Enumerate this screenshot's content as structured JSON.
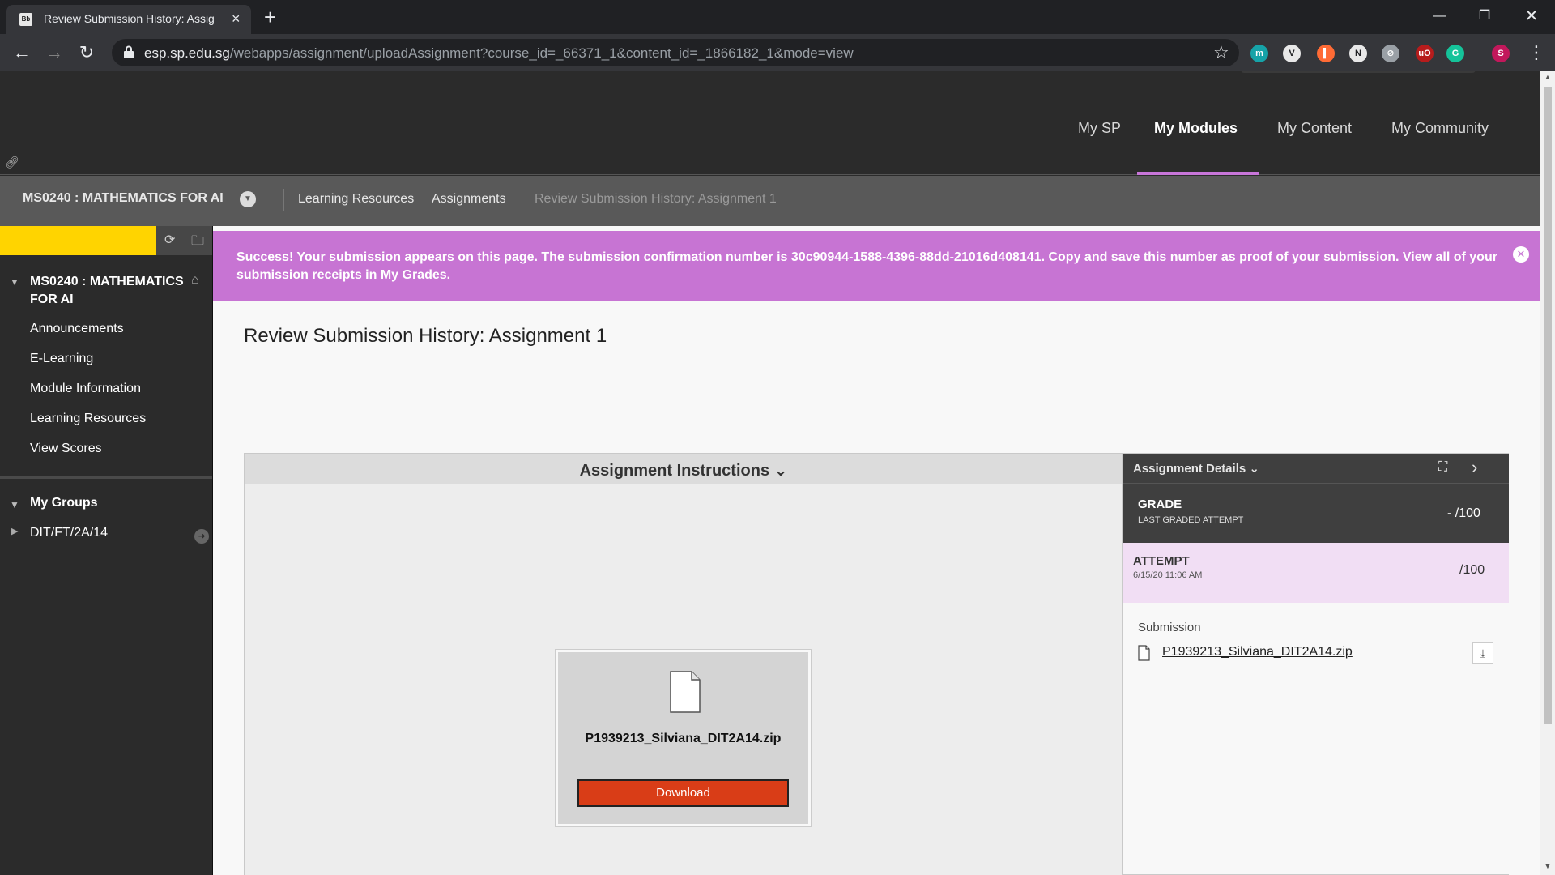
{
  "browser": {
    "tab_title": "Review Submission History: Assig",
    "favicon_text": "Bb",
    "url_host": "esp.sp.edu.sg",
    "url_path": "/webapps/assignment/uploadAssignment?course_id=_66371_1&content_id=_1866182_1&mode=view",
    "extensions": [
      {
        "name": "meet-extension-icon",
        "glyph": "m",
        "color": "#16a3a8"
      },
      {
        "name": "v-extension-icon",
        "glyph": "V",
        "color": "#e8e8e8"
      },
      {
        "name": "bookmark-extension-icon",
        "glyph": "▌",
        "color": "#ff6b35"
      },
      {
        "name": "notion-extension-icon",
        "glyph": "N",
        "color": "#e8e8e8"
      },
      {
        "name": "compass-extension-icon",
        "glyph": "⊘",
        "color": "#9aa0a6"
      },
      {
        "name": "ublock-extension-icon",
        "glyph": "uO",
        "color": "#b71c1c"
      },
      {
        "name": "grammarly-extension-icon",
        "glyph": "G",
        "color": "#15c39a"
      },
      {
        "name": "profile-avatar-icon",
        "glyph": "S",
        "color": "#c2185b"
      }
    ]
  },
  "top_nav": {
    "my_sp": "My SP",
    "my_modules": "My Modules",
    "my_content": "My Content",
    "my_community": "My Community"
  },
  "breadcrumbs": {
    "course": "MS0240 : MATHEMATICS FOR AI",
    "learning_resources": "Learning Resources",
    "assignments": "Assignments",
    "current": "Review Submission History: Assignment 1"
  },
  "sidebar": {
    "course_title": "MS0240 : MATHEMATICS FOR AI",
    "links": {
      "announcements": "Announcements",
      "elearning": "E-Learning",
      "module_info": "Module Information",
      "learning_resources": "Learning Resources",
      "view_scores": "View Scores"
    },
    "groups_title": "My Groups",
    "group_item": "DIT/FT/2A/14"
  },
  "alert": {
    "message": "Success! Your submission appears on this page. The submission confirmation number is 30c90944-1588-4396-88dd-21016d408141. Copy and save this number as proof of your submission. View all of your submission receipts in My Grades."
  },
  "main": {
    "page_title": "Review Submission History: Assignment 1",
    "instructions_label": "Assignment Instructions",
    "file_name": "P1939213_Silviana_DIT2A14.zip",
    "download_label": "Download"
  },
  "details": {
    "toggle_label": "Assignment Details",
    "grade_label": "GRADE",
    "grade_sub": "LAST GRADED ATTEMPT",
    "grade_value": "- /100",
    "attempt_label": "ATTEMPT",
    "attempt_date": "6/15/20 11:06 AM",
    "attempt_value": "/100",
    "submission_label": "Submission",
    "submission_file": "P1939213_Silviana_DIT2A14.zip"
  },
  "colors": {
    "alert_bg": "#c774d3",
    "active_nav_underline": "#c876d9",
    "sidebar_accent": "#ffd400",
    "download_button": "#d93d17",
    "attempt_row": "#f1def4"
  }
}
